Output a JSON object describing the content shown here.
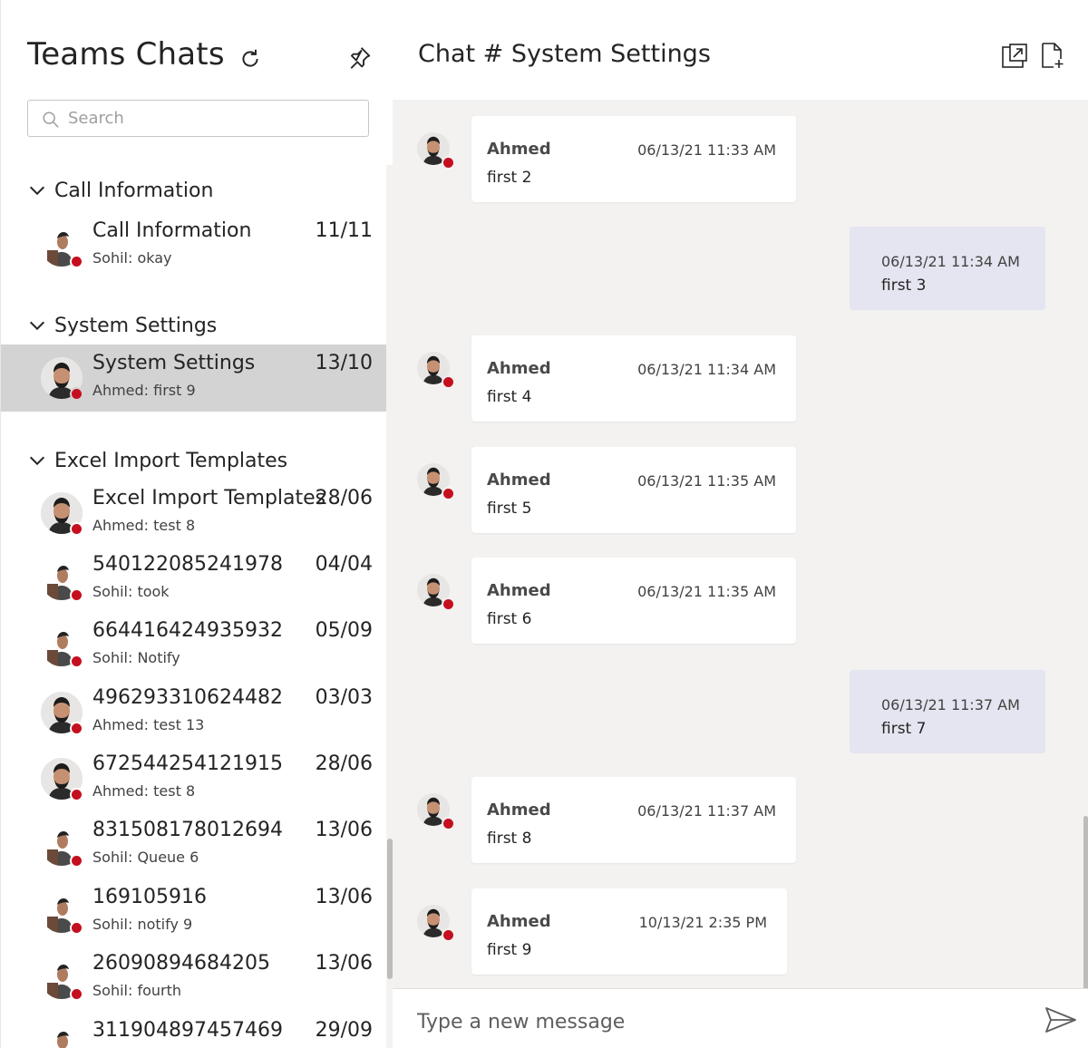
{
  "sidebar": {
    "title": "Teams Chats",
    "search_placeholder": "Search",
    "groups": [
      {
        "name": "Call Information",
        "chats": [
          {
            "title": "Call Information",
            "date": "11/11",
            "preview": "Sohil: okay",
            "avatar": "sohil"
          }
        ]
      },
      {
        "name": "System Settings",
        "chats": [
          {
            "title": "System Settings",
            "date": "13/10",
            "preview": "Ahmed: first 9",
            "avatar": "ahmed",
            "selected": true
          }
        ]
      },
      {
        "name": "Excel Import Templates",
        "chats": [
          {
            "title": "Excel Import Templates",
            "date": "28/06",
            "preview": "Ahmed: test 8",
            "avatar": "ahmed"
          },
          {
            "title": "540122085241978",
            "date": "04/04",
            "preview": "Sohil: took",
            "avatar": "sohil"
          },
          {
            "title": "664416424935932",
            "date": "05/09",
            "preview": "Sohil: Notify",
            "avatar": "sohil"
          },
          {
            "title": "496293310624482",
            "date": "03/03",
            "preview": "Ahmed: test 13",
            "avatar": "ahmed"
          },
          {
            "title": "672544254121915",
            "date": "28/06",
            "preview": "Ahmed: test 8",
            "avatar": "ahmed"
          },
          {
            "title": "831508178012694",
            "date": "13/06",
            "preview": "Sohil: Queue 6",
            "avatar": "sohil"
          },
          {
            "title": "169105916",
            "date": "13/06",
            "preview": "Sohil: notify 9",
            "avatar": "sohil"
          },
          {
            "title": "26090894684205",
            "date": "13/06",
            "preview": "Sohil: fourth",
            "avatar": "sohil"
          },
          {
            "title": "311904897457469",
            "date": "29/09",
            "preview": "",
            "avatar": "sohil"
          }
        ]
      }
    ]
  },
  "chat": {
    "title": "Chat # System Settings",
    "messages": [
      {
        "dir": "in",
        "sender": "Ahmed",
        "time": "06/13/21 11:33 AM",
        "text": "first 2"
      },
      {
        "dir": "out",
        "time": "06/13/21 11:34 AM",
        "text": "first 3"
      },
      {
        "dir": "in",
        "sender": "Ahmed",
        "time": "06/13/21 11:34 AM",
        "text": "first 4"
      },
      {
        "dir": "in",
        "sender": "Ahmed",
        "time": "06/13/21 11:35 AM",
        "text": "first 5"
      },
      {
        "dir": "in",
        "sender": "Ahmed",
        "time": "06/13/21 11:35 AM",
        "text": "first 6"
      },
      {
        "dir": "out",
        "time": "06/13/21 11:37 AM",
        "text": "first 7"
      },
      {
        "dir": "in",
        "sender": "Ahmed",
        "time": "06/13/21 11:37 AM",
        "text": "first 8"
      },
      {
        "dir": "in",
        "sender": "Ahmed",
        "time": "10/13/21 2:35 PM",
        "text": "first 9"
      }
    ],
    "composer_placeholder": "Type a new message"
  },
  "colors": {
    "presence_busy": "#c50f1f",
    "selected_bg": "#d3d3d3",
    "chat_bg": "#f3f2f1",
    "outgoing_bubble": "#e5e5f1"
  },
  "icons": [
    "refresh-icon",
    "pin-icon",
    "search-icon",
    "chevron-down-icon",
    "popout-icon",
    "new-document-icon",
    "send-icon"
  ]
}
